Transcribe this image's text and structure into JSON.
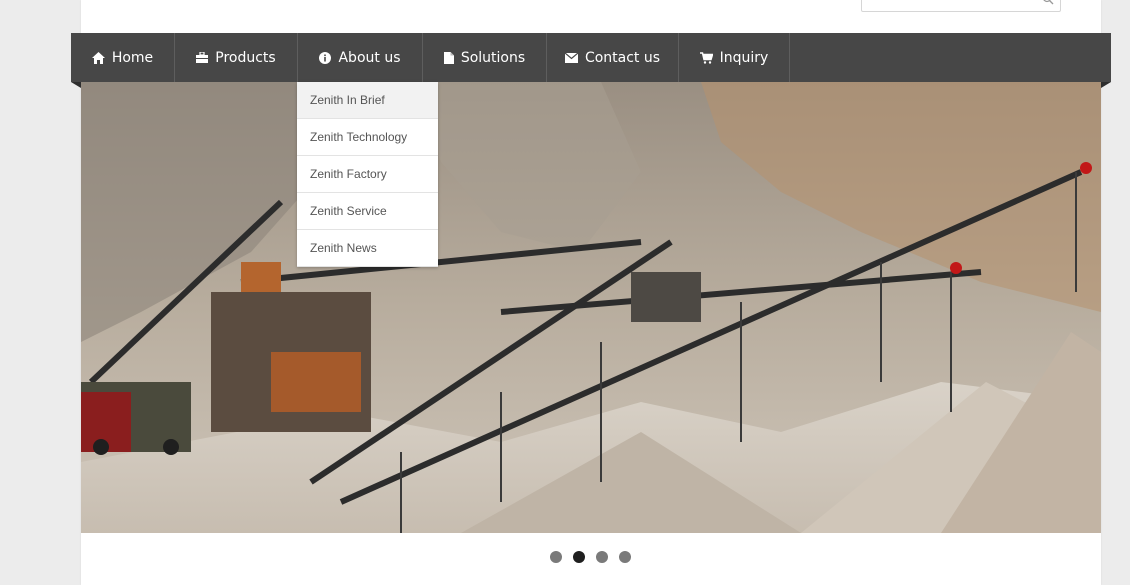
{
  "nav": {
    "items": [
      {
        "label": "Home",
        "icon": "home-icon"
      },
      {
        "label": "Products",
        "icon": "briefcase-icon"
      },
      {
        "label": "About us",
        "icon": "info-icon"
      },
      {
        "label": "Solutions",
        "icon": "document-icon"
      },
      {
        "label": "Contact us",
        "icon": "envelope-icon"
      },
      {
        "label": "Inquiry",
        "icon": "cart-icon"
      }
    ]
  },
  "dropdown": {
    "items": [
      "Zenith In Brief",
      "Zenith Technology",
      "Zenith Factory",
      "Zenith Service",
      "Zenith News"
    ],
    "active_index": 0
  },
  "slider": {
    "slide_count": 4,
    "active_slide": 2,
    "image": "quarry-crushing-plant-conveyors"
  },
  "colors": {
    "nav_bg": "#474747",
    "page_bg": "#ececec",
    "dot_active": "#1f1f1f",
    "dot_inactive": "#7a7a7a"
  }
}
